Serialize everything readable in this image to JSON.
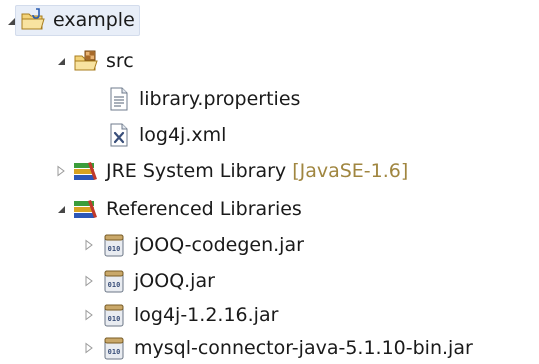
{
  "tree": {
    "project": {
      "label": "example",
      "expanded": true,
      "selected": true,
      "icon": "java-project-folder-icon"
    },
    "src": {
      "label": "src",
      "expanded": true,
      "icon": "source-package-folder-icon"
    },
    "files": [
      {
        "label": "library.properties",
        "icon": "properties-file-icon"
      },
      {
        "label": "log4j.xml",
        "icon": "xml-file-icon"
      }
    ],
    "jre": {
      "label": "JRE System Library",
      "decoration": "[JavaSE-1.6]",
      "expanded": false,
      "icon": "library-books-icon"
    },
    "referenced": {
      "label": "Referenced Libraries",
      "expanded": true,
      "icon": "library-books-icon"
    },
    "jars": [
      {
        "label": "jOOQ-codegen.jar",
        "icon": "jar-file-icon"
      },
      {
        "label": "jOOQ.jar",
        "icon": "jar-file-icon"
      },
      {
        "label": "log4j-1.2.16.jar",
        "icon": "jar-file-icon"
      },
      {
        "label": "mysql-connector-java-5.1.10-bin.jar",
        "icon": "jar-file-icon"
      }
    ]
  },
  "colors": {
    "selection_bg": "#e8eef8",
    "decoration_text": "#a08640",
    "twisty_expanded": "#474747",
    "twisty_collapsed": "#9a9a9a"
  }
}
